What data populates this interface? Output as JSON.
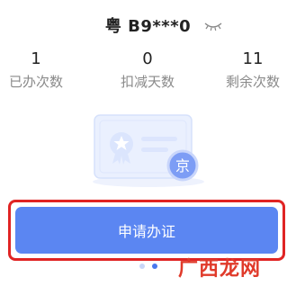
{
  "license": {
    "plate": "粤 B9***0",
    "visibility_icon": "eye-closed-icon"
  },
  "stats": [
    {
      "value": "1",
      "label": "已办次数"
    },
    {
      "value": "0",
      "label": "扣减天数"
    },
    {
      "value": "11",
      "label": "剩余次数"
    }
  ],
  "illustration": {
    "badge_text": "京",
    "icon": "permit-card-illustration"
  },
  "actions": {
    "apply_label": "申请办证"
  },
  "pager": {
    "count": 2,
    "active_index": 1
  },
  "watermark": {
    "text": "广西龙网"
  },
  "colors": {
    "accent": "#5b86f2",
    "highlight_border": "#e02424",
    "dot_active": "#4a78ee",
    "dot_inactive": "#c8d6f8",
    "watermark": "#e03a2a"
  }
}
